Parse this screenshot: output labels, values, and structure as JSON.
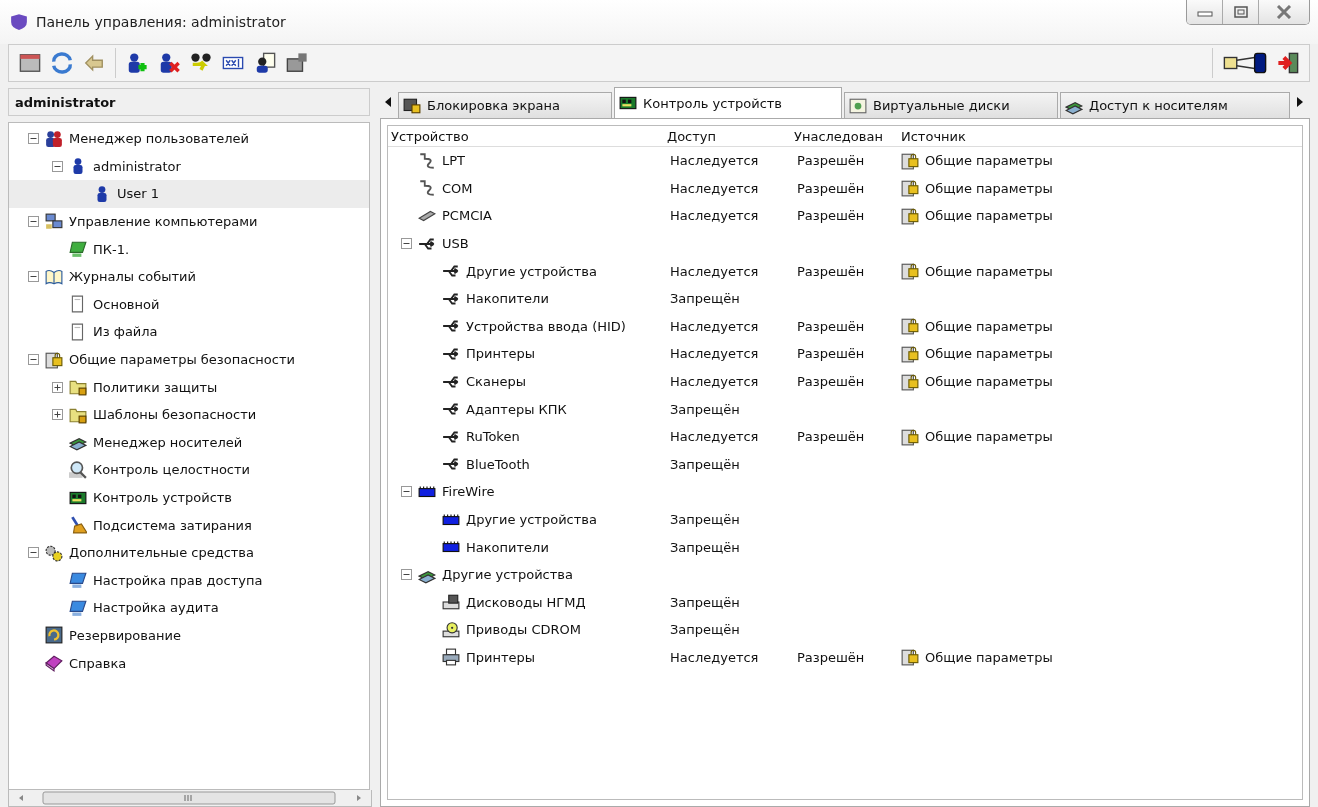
{
  "window": {
    "title": "Панель управления: administrator"
  },
  "sidebar": {
    "header": "administrator",
    "tree": [
      {
        "label": "Менеджер пользователей",
        "kind": "users",
        "expanded": true,
        "selected": false,
        "children": [
          {
            "label": "administrator",
            "kind": "user",
            "expanded": true,
            "selected": false,
            "children": [
              {
                "label": "User 1",
                "kind": "user",
                "selected": true
              }
            ]
          }
        ]
      },
      {
        "label": "Управление компьютерами",
        "kind": "computers",
        "expanded": true,
        "selected": false,
        "children": [
          {
            "label": "ПК-1.",
            "kind": "computer",
            "selected": false
          }
        ]
      },
      {
        "label": "Журналы событий",
        "kind": "book",
        "expanded": true,
        "selected": false,
        "children": [
          {
            "label": "Основной",
            "kind": "page",
            "selected": false
          },
          {
            "label": "Из файла",
            "kind": "page",
            "selected": false
          }
        ]
      },
      {
        "label": "Общие параметры безопасности",
        "kind": "security",
        "expanded": true,
        "selected": false,
        "children": [
          {
            "label": "Политики защиты",
            "kind": "folder",
            "expanded": false,
            "selected": false
          },
          {
            "label": "Шаблоны безопасности",
            "kind": "folder",
            "expanded": false,
            "selected": false
          },
          {
            "label": "Менеджер носителей",
            "kind": "media",
            "selected": false
          },
          {
            "label": "Контроль целостности",
            "kind": "magnifier",
            "selected": false
          },
          {
            "label": "Контроль устройств",
            "kind": "board",
            "selected": false
          },
          {
            "label": "Подсистема затирания",
            "kind": "broom",
            "selected": false
          }
        ]
      },
      {
        "label": "Дополнительные средства",
        "kind": "gears",
        "expanded": true,
        "selected": false,
        "children": [
          {
            "label": "Настройка прав доступа",
            "kind": "monitor",
            "selected": false
          },
          {
            "label": "Настройка аудита",
            "kind": "monitor",
            "selected": false
          }
        ]
      },
      {
        "label": "Резервирование",
        "kind": "backup",
        "selected": false
      },
      {
        "label": "Справка",
        "kind": "help",
        "selected": false
      }
    ]
  },
  "tabs": [
    {
      "label": "Блокировка экрана",
      "kind": "lock",
      "selected": false
    },
    {
      "label": "Контроль устройств",
      "kind": "board",
      "selected": true
    },
    {
      "label": "Виртуальные диски",
      "kind": "disk",
      "selected": false
    },
    {
      "label": "Доступ к носителям",
      "kind": "media",
      "selected": false
    }
  ],
  "table": {
    "columns": [
      "Устройство",
      "Доступ",
      "Унаследован",
      "Источник"
    ],
    "rows": [
      {
        "device": "LPT",
        "kind": "port",
        "access": "Наследуется",
        "inherited": "Разрешён",
        "source": "Общие параметры"
      },
      {
        "device": "COM",
        "kind": "port",
        "access": "Наследуется",
        "inherited": "Разрешён",
        "source": "Общие параметры"
      },
      {
        "device": "PCMCIA",
        "kind": "pcmcia",
        "access": "Наследуется",
        "inherited": "Разрешён",
        "source": "Общие параметры"
      },
      {
        "device": "USB",
        "kind": "usb",
        "expanded": true,
        "children": [
          {
            "device": "Другие устройства",
            "kind": "usb",
            "access": "Наследуется",
            "inherited": "Разрешён",
            "source": "Общие параметры"
          },
          {
            "device": "Накопители",
            "kind": "usb",
            "access": "Запрещён"
          },
          {
            "device": "Устройства ввода (HID)",
            "kind": "usb",
            "access": "Наследуется",
            "inherited": "Разрешён",
            "source": "Общие параметры"
          },
          {
            "device": "Принтеры",
            "kind": "usb",
            "access": "Наследуется",
            "inherited": "Разрешён",
            "source": "Общие параметры"
          },
          {
            "device": "Сканеры",
            "kind": "usb",
            "access": "Наследуется",
            "inherited": "Разрешён",
            "source": "Общие параметры"
          },
          {
            "device": "Адаптеры КПК",
            "kind": "usb",
            "access": "Запрещён"
          },
          {
            "device": "RuToken",
            "kind": "usb",
            "access": "Наследуется",
            "inherited": "Разрешён",
            "source": "Общие параметры"
          },
          {
            "device": "BlueTooth",
            "kind": "usb",
            "access": "Запрещён"
          }
        ]
      },
      {
        "device": "FireWire",
        "kind": "firewire",
        "expanded": true,
        "children": [
          {
            "device": "Другие устройства",
            "kind": "firewire",
            "access": "Запрещён"
          },
          {
            "device": "Накопители",
            "kind": "firewire",
            "access": "Запрещён"
          }
        ]
      },
      {
        "device": "Другие устройства",
        "kind": "media",
        "expanded": true,
        "children": [
          {
            "device": "Дисководы НГМД",
            "kind": "floppy",
            "access": "Запрещён"
          },
          {
            "device": "Приводы CDROM",
            "kind": "cdrom",
            "access": "Запрещён"
          },
          {
            "device": "Принтеры",
            "kind": "printer",
            "access": "Наследуется",
            "inherited": "Разрешён",
            "source": "Общие параметры"
          }
        ]
      }
    ]
  }
}
